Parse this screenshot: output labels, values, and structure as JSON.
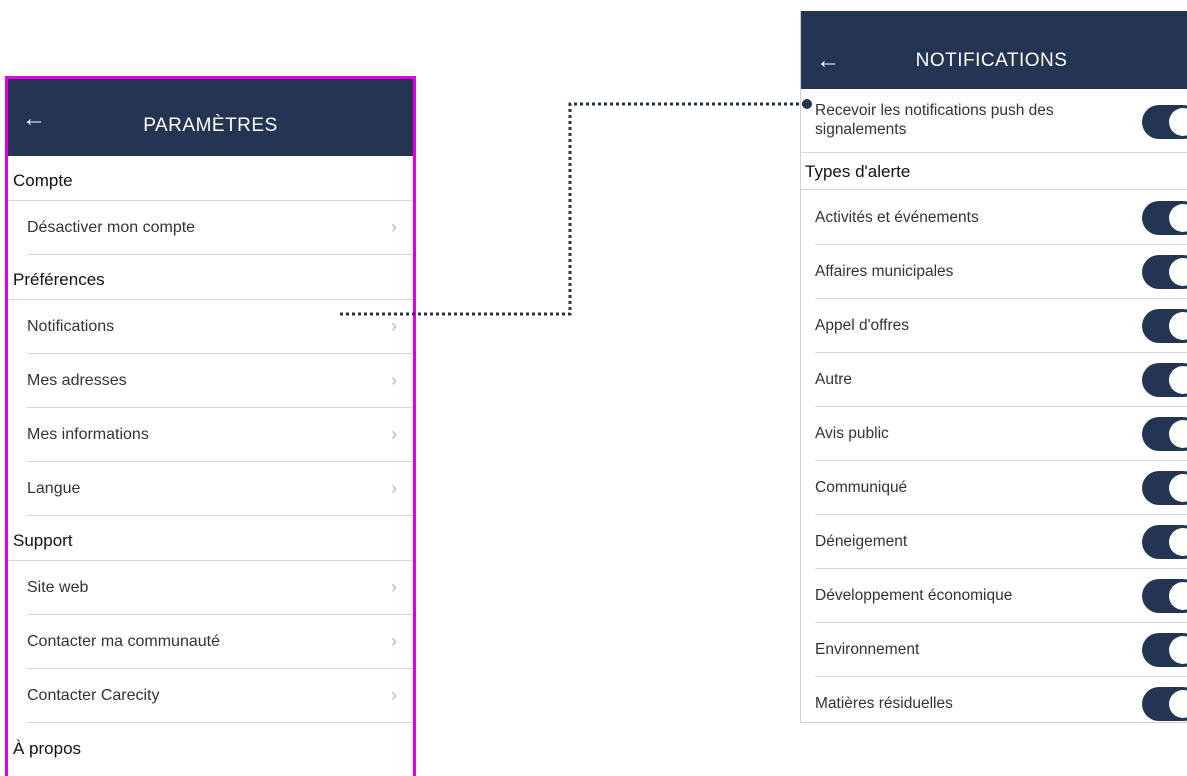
{
  "settings": {
    "title": "PARAMÈTRES",
    "sections": [
      {
        "header": "Compte",
        "items": [
          "Désactiver mon compte"
        ]
      },
      {
        "header": "Préférences",
        "items": [
          "Notifications",
          "Mes adresses",
          "Mes informations",
          "Langue"
        ]
      },
      {
        "header": "Support",
        "items": [
          "Site web",
          "Contacter ma communauté",
          "Contacter Carecity"
        ]
      },
      {
        "header": "À propos",
        "items": []
      }
    ]
  },
  "notifications": {
    "title": "NOTIFICATIONS",
    "push_label": "Recevoir les notifications push des signalements",
    "push_enabled": true,
    "types_header": "Types d'alerte",
    "alerts": [
      {
        "label": "Activités et événements",
        "enabled": true
      },
      {
        "label": "Affaires municipales",
        "enabled": true
      },
      {
        "label": "Appel d'offres",
        "enabled": true
      },
      {
        "label": "Autre",
        "enabled": true
      },
      {
        "label": "Avis public",
        "enabled": true
      },
      {
        "label": "Communiqué",
        "enabled": true
      },
      {
        "label": "Déneigement",
        "enabled": true
      },
      {
        "label": "Développement économique",
        "enabled": true
      },
      {
        "label": "Environnement",
        "enabled": true
      },
      {
        "label": "Matières résiduelles",
        "enabled": true
      }
    ]
  },
  "icons": {
    "back": "arrow-left-icon",
    "chevron": "chevron-right-icon"
  },
  "colors": {
    "header_bg": "#243553",
    "highlight_border": "#e100e6",
    "toggle_on": "#243553"
  }
}
